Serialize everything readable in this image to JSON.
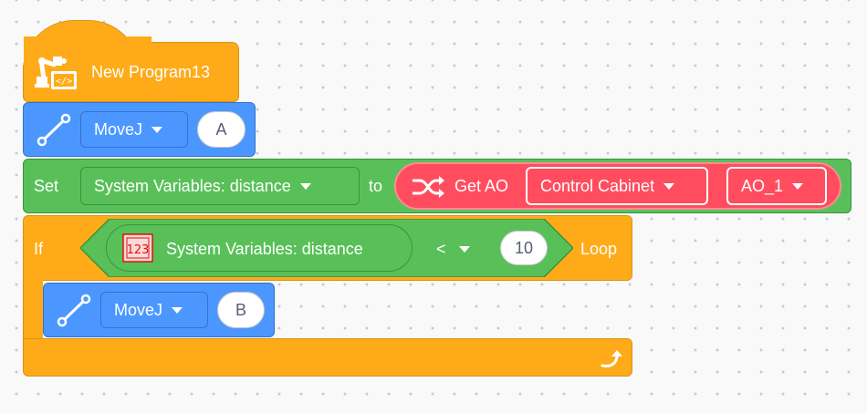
{
  "program": {
    "title": "New Program13"
  },
  "blocks": {
    "movej_1": {
      "dropdown": "MoveJ",
      "point": "A"
    },
    "set": {
      "label": "Set",
      "variable": "System Variables: distance",
      "to_label": "to",
      "get_ao": {
        "label": "Get AO",
        "cabinet": "Control Cabinet",
        "channel": "AO_1"
      }
    },
    "if": {
      "label": "If",
      "condition": {
        "icon_text": "123",
        "variable": "System Variables:  distance",
        "operator": "<",
        "value": "10"
      },
      "loop_label": "Loop"
    },
    "movej_2": {
      "dropdown": "MoveJ",
      "point": "B"
    }
  },
  "colors": {
    "event": "#ffab19",
    "motion": "#4c97ff",
    "variables": "#59c059",
    "operators_green": "#389438",
    "io": "#ff4d5f"
  },
  "icons": [
    "robot-arm-icon",
    "line-path-icon",
    "shuffle-icon",
    "number-variable-icon",
    "loop-arrow-icon",
    "chevron-down-icon"
  ]
}
